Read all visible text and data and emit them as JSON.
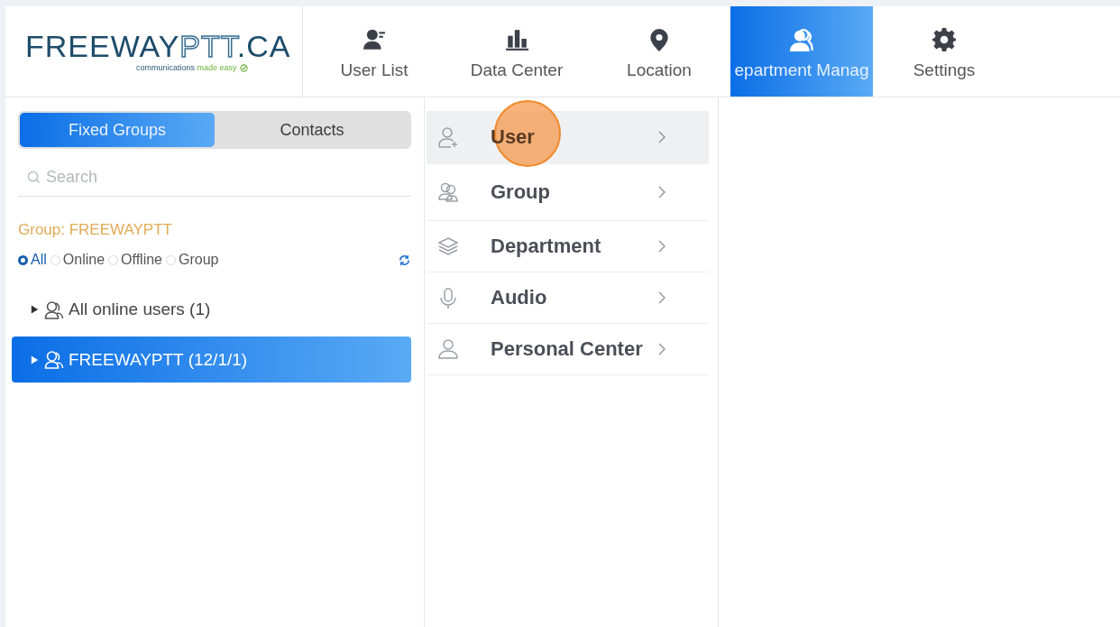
{
  "header": {
    "logo": {
      "parts": [
        {
          "text": "FREEWAY",
          "kind": "solid"
        },
        {
          "text": "PTT",
          "kind": "outline"
        },
        {
          "text": ".CA",
          "kind": "solid"
        }
      ],
      "tagline": [
        {
          "text": "communications",
          "kind": "plain"
        },
        {
          "text": "made easy",
          "kind": "accent"
        }
      ]
    },
    "nav": [
      {
        "label": "User List",
        "selected": false
      },
      {
        "label": "Data Center",
        "selected": false
      },
      {
        "label": "Location",
        "selected": false
      },
      {
        "label": "epartment Manag",
        "selected": true
      },
      {
        "label": "Settings",
        "selected": false
      }
    ]
  },
  "left_panel": {
    "tabs": [
      {
        "label": "Fixed Groups",
        "selected": true
      },
      {
        "label": "Contacts",
        "selected": false
      }
    ],
    "search": {
      "placeholder": "Search"
    },
    "group_label": "Group: FREEWAYPTT",
    "filters": [
      {
        "label": "All",
        "selected": true
      },
      {
        "label": "Online",
        "selected": false
      },
      {
        "label": "Offline",
        "selected": false
      },
      {
        "label": "Group",
        "selected": false
      }
    ],
    "tree": [
      {
        "label": "All online users (1)",
        "selected": false,
        "expanded": false
      },
      {
        "label": "FREEWAYPTT (12/1/1)",
        "selected": true,
        "expanded": false
      }
    ]
  },
  "menu": [
    {
      "label": "User",
      "selected": true
    },
    {
      "label": "Group",
      "selected": false
    },
    {
      "label": "Department",
      "selected": false
    },
    {
      "label": "Audio",
      "selected": false
    },
    {
      "label": "Personal Center",
      "selected": false
    }
  ]
}
